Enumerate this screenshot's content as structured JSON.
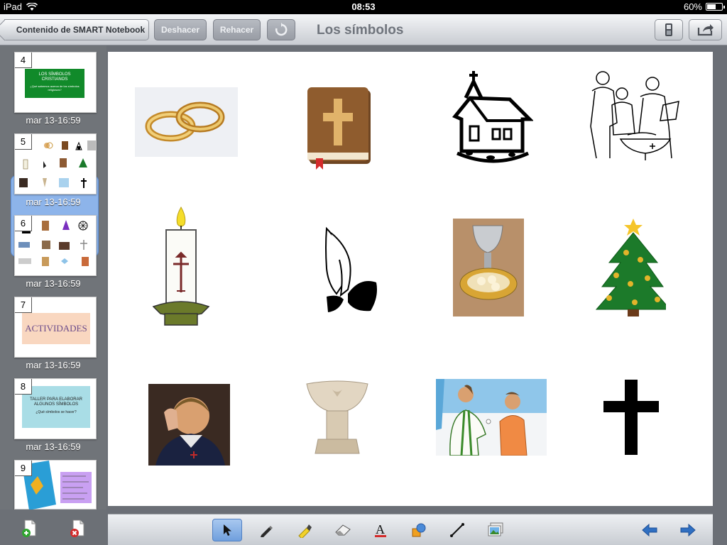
{
  "status_bar": {
    "device": "iPad",
    "time": "08:53",
    "battery": "60%",
    "battery_level": 0.6
  },
  "nav": {
    "back_label": "Contenido de SMART Notebook",
    "undo_label": "Deshacer",
    "redo_label": "Rehacer",
    "title": "Los símbolos"
  },
  "slides": [
    {
      "number": "4",
      "time": "mar 13-16:59",
      "title_line1": "LOS SÍMBOLOS",
      "title_line2": "CRISTIANOS",
      "subtitle": "¿Qué sabemos acerca de los símbolos religiosos?"
    },
    {
      "number": "5",
      "time": "mar 13-16:59"
    },
    {
      "number": "6",
      "time": "mar 13-16:59"
    },
    {
      "number": "7",
      "time": "mar 13-16:59",
      "heading": "ACTIVIDADES"
    },
    {
      "number": "8",
      "time": "mar 13-16:59",
      "title_line1": "TALLER PARA ELABORAR",
      "title_line2": "ALGUNOS SÍMBOLOS",
      "subtitle": "¿Qué símbolos se hacer?"
    },
    {
      "number": "9"
    }
  ],
  "canvas_images": [
    "rings-image",
    "bible-image",
    "church-image",
    "baptism-drawing-image",
    "candle-image",
    "praying-hands-image",
    "chalice-image",
    "christmas-tree-image",
    "child-crossing-image",
    "baptismal-font-image",
    "communion-image",
    "cross-image"
  ],
  "colors": {
    "selected_slide": "#8db4ea",
    "active_tool": "#6f9fdd",
    "arrow_blue": "#2f6fc2"
  }
}
